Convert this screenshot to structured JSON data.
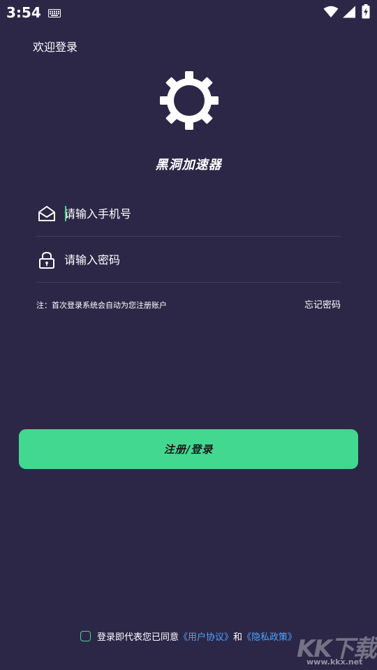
{
  "status_bar": {
    "time": "3:54",
    "icons": [
      "keyboard-icon",
      "wifi-icon",
      "signal-icon",
      "battery-charging-icon"
    ]
  },
  "header": {
    "welcome": "欢迎登录",
    "logo_icon": "gear-icon",
    "app_name": "黑洞加速器"
  },
  "form": {
    "phone_placeholder": "请输入手机号",
    "phone_icon": "mail-open-icon",
    "password_placeholder": "请输入密码",
    "password_icon": "lock-icon",
    "note": "注：首次登录系统会自动为您注册账户",
    "forgot_label": "忘记密码"
  },
  "login_button": "注册/登录",
  "agreement": {
    "prefix": "登录即代表您已同意",
    "user_agreement": "《用户协议》",
    "and": "和",
    "privacy_policy": "《隐私政策》"
  },
  "watermark": {
    "main": "KK下载",
    "site": "www.kkx.net"
  },
  "colors": {
    "background": "#2c2747",
    "accent": "#43d890",
    "link": "#4da3ff",
    "divider": "#433e5c"
  }
}
